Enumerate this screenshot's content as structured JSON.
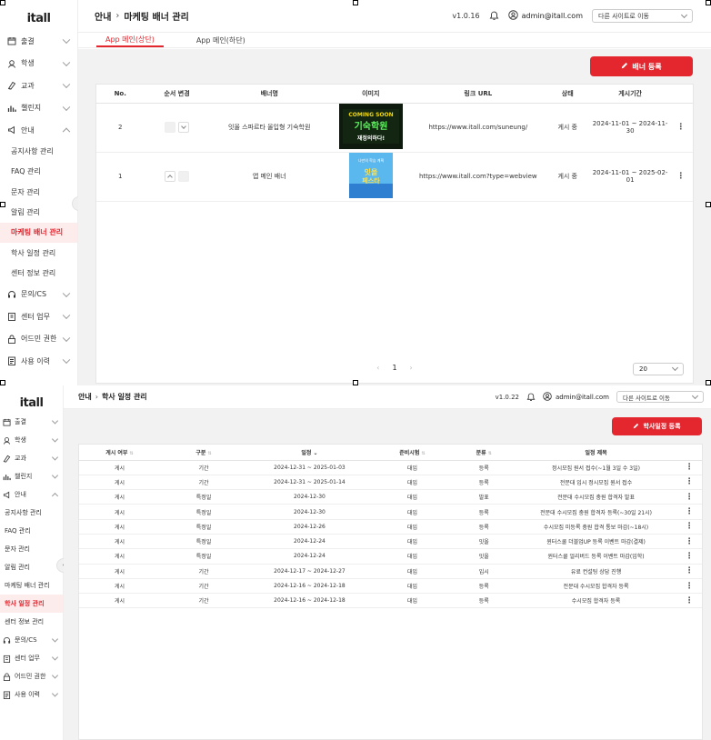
{
  "app": {
    "logo": "itall",
    "version1": "v1.0.16",
    "version2": "v1.0.22",
    "admin_email": "admin@itall.com",
    "site_select": "다른 사이트로 이동"
  },
  "sidebar": {
    "items": [
      {
        "label": "출결",
        "icon": "calendar-icon"
      },
      {
        "label": "학생",
        "icon": "student-icon"
      },
      {
        "label": "교과",
        "icon": "book-icon"
      },
      {
        "label": "챌린지",
        "icon": "chart-icon"
      },
      {
        "label": "안내",
        "icon": "megaphone-icon"
      }
    ],
    "sub_items": [
      "공지사항 관리",
      "FAQ 관리",
      "문자 관리",
      "알림 관리",
      "마케팅 배너 관리",
      "학사 일정 관리",
      "센터 정보 관리"
    ],
    "bottom_items": [
      {
        "label": "문의/CS",
        "icon": "headset-icon"
      },
      {
        "label": "센터 업무",
        "icon": "clipboard-icon"
      },
      {
        "label": "어드민 권한",
        "icon": "lock-icon"
      },
      {
        "label": "사용 이력",
        "icon": "history-icon"
      }
    ]
  },
  "page1": {
    "crumb_parent": "안내",
    "crumb_current": "마케팅 배너 관리",
    "tabs": [
      "App 메인(상단)",
      "App 메인(하단)"
    ],
    "register_button": "배너 등록",
    "columns": [
      "No.",
      "순서 변경",
      "배너명",
      "이미지",
      "링크 URL",
      "상태",
      "게시기간"
    ],
    "rows": [
      {
        "no": "2",
        "name": "잇올 스파르타 올입형 기숙학원",
        "url": "https://www.itall.com/suneung/",
        "status": "게시 중",
        "period": "2024-11-01 ~ 2024-11-30"
      },
      {
        "no": "1",
        "name": "앱 메인 배너",
        "url": "https://www.itall.com?type=webview",
        "status": "게시 중",
        "period": "2024-11-01 ~ 2025-02-01"
      }
    ],
    "banner1_text": {
      "line1": "COMING SOON",
      "line2": "기숙학원",
      "line3": "재정의하다!"
    },
    "banner2_text": {
      "line1": "나만의 학습 계획",
      "line2": "잇올",
      "line3": "페스타"
    },
    "page": "1",
    "page_size": "20"
  },
  "page2": {
    "crumb_parent": "안내",
    "crumb_current": "학사 일정 관리",
    "register_button": "학사일정 등록",
    "columns": [
      "게시 여부",
      "구분",
      "일정",
      "준비시험",
      "분류",
      "일정 제목"
    ],
    "rows": [
      [
        "게시",
        "기간",
        "2024-12-31 ~ 2025-01-03",
        "대입",
        "등록",
        "정시모집 원서 접수(~1월 3일 수 3일)"
      ],
      [
        "게시",
        "기간",
        "2024-12-31 ~ 2025-01-14",
        "대입",
        "등록",
        "전문대 입시 정시모집 원서 접수"
      ],
      [
        "게시",
        "특정일",
        "2024-12-30",
        "대입",
        "발표",
        "전문대 수시모집 충원 합격자 발표"
      ],
      [
        "게시",
        "특정일",
        "2024-12-30",
        "대입",
        "등록",
        "전문대 수시모집 충원 합격자 등록(~30일 21시)"
      ],
      [
        "게시",
        "특정일",
        "2024-12-26",
        "대입",
        "등록",
        "수시모집 미등록 충원 합격 통보 마감(~18시)"
      ],
      [
        "게시",
        "특정일",
        "2024-12-24",
        "대입",
        "잇올",
        "윈터스쿨 더블업UP 등록 이벤트 마감(결제)"
      ],
      [
        "게시",
        "특정일",
        "2024-12-24",
        "대입",
        "잇올",
        "윈터스쿨 얼리버드 등록 이벤트 마감(입학)"
      ],
      [
        "게시",
        "기간",
        "2024-12-17 ~ 2024-12-27",
        "대입",
        "입시",
        "유료 컨설팅 상담 진행"
      ],
      [
        "게시",
        "기간",
        "2024-12-16 ~ 2024-12-18",
        "대입",
        "등록",
        "전문대 수시모집 합격자 등록"
      ],
      [
        "게시",
        "기간",
        "2024-12-16 ~ 2024-12-18",
        "대입",
        "등록",
        "수시모집 합격자 등록"
      ]
    ]
  },
  "colors": {
    "accent": "#e4262f",
    "active_bg": "#fdecec",
    "content_bg": "#f2f2f2"
  }
}
